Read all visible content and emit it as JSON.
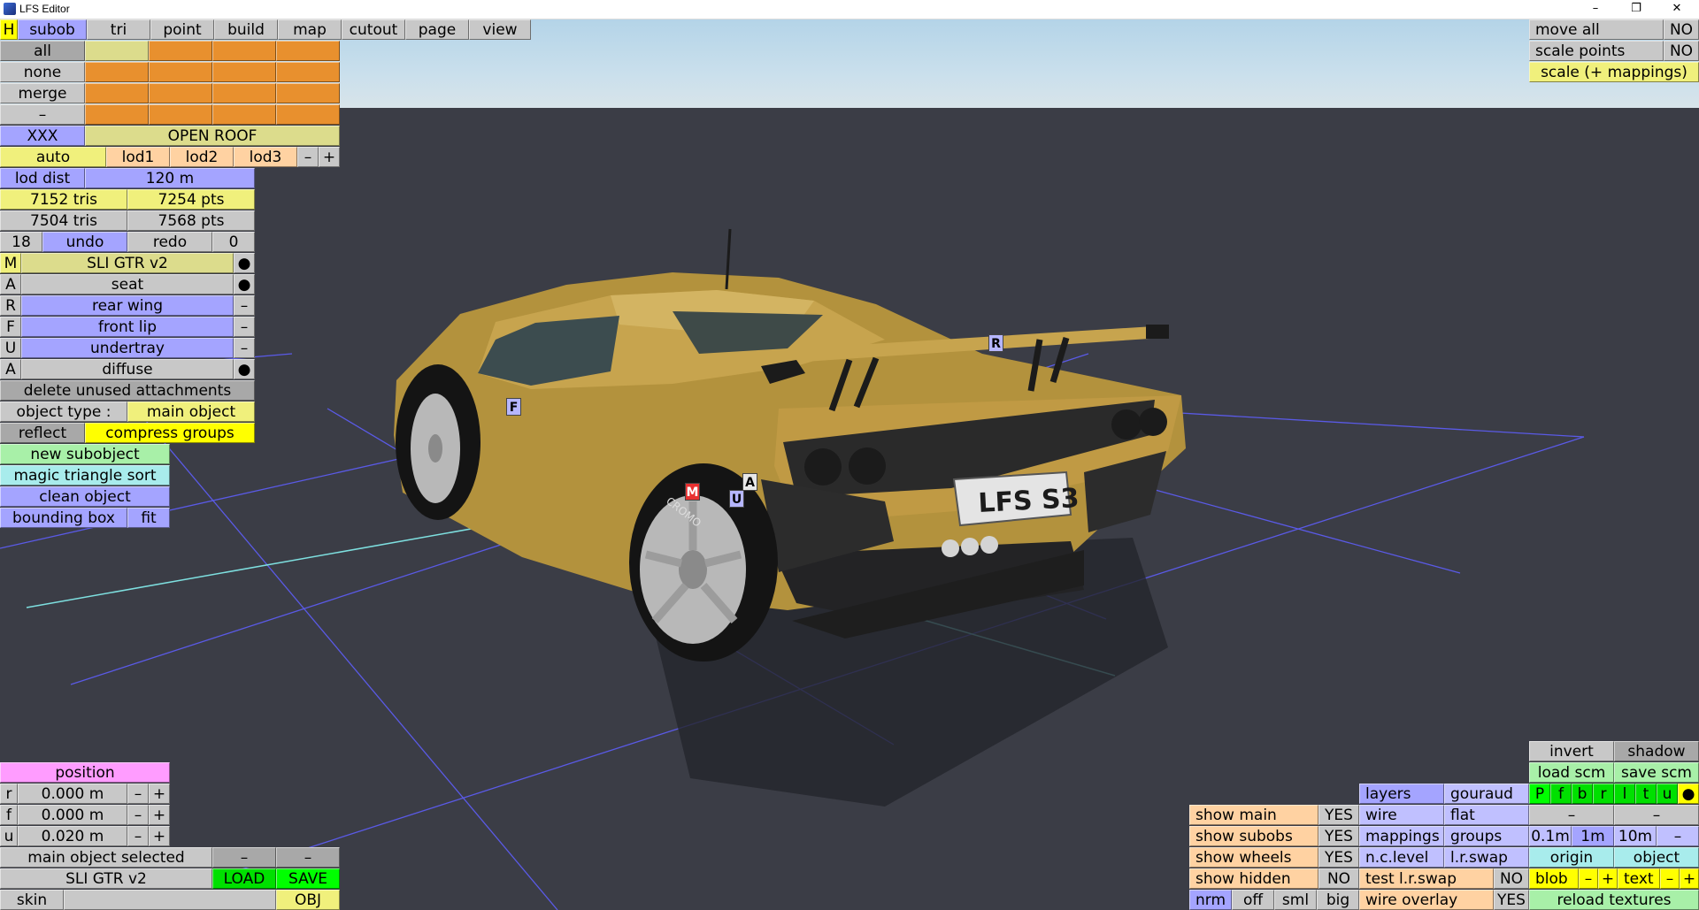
{
  "window": {
    "title": "LFS Editor",
    "minimize": "–",
    "restore": "❐",
    "close": "✕"
  },
  "top_tabs": {
    "h": "H",
    "subob": "subob",
    "tri": "tri",
    "point": "point",
    "build": "build",
    "map": "map",
    "cutout": "cutout",
    "page": "page",
    "view": "view"
  },
  "select": {
    "all": "all",
    "none": "none",
    "merge": "merge",
    "dash": "–",
    "xxx": "XXX",
    "open_roof": "OPEN ROOF"
  },
  "lod": {
    "auto": "auto",
    "lod1": "lod1",
    "lod2": "lod2",
    "lod3": "lod3",
    "minus": "–",
    "plus": "+",
    "lod_dist_label": "lod dist",
    "lod_dist_value": "120 m"
  },
  "stats": {
    "tris1": "7152 tris",
    "pts1": "7254 pts",
    "tris2": "7504 tris",
    "pts2": "7568 pts"
  },
  "history": {
    "undo_count": "18",
    "undo": "undo",
    "redo": "redo",
    "redo_count": "0"
  },
  "subobjects": [
    {
      "key": "M",
      "name": "SLI GTR v2",
      "flag": "●"
    },
    {
      "key": "A",
      "name": "seat",
      "flag": "●"
    },
    {
      "key": "R",
      "name": "rear wing",
      "flag": "–"
    },
    {
      "key": "F",
      "name": "front lip",
      "flag": "–"
    },
    {
      "key": "U",
      "name": "undertray",
      "flag": "–"
    },
    {
      "key": "A",
      "name": "diffuse",
      "flag": "●"
    }
  ],
  "actions": {
    "delete_unused": "delete unused attachments",
    "object_type_label": "object type :",
    "object_type_value": "main object",
    "reflect": "reflect",
    "compress_groups": "compress groups",
    "new_subobject": "new subobject",
    "magic_sort": "magic triangle sort",
    "clean_object": "clean object",
    "bounding_box": "bounding box",
    "fit": "fit"
  },
  "top_right": {
    "move_all": "move all",
    "move_all_val": "NO",
    "scale_points": "scale points",
    "scale_points_val": "NO",
    "scale_mappings": "scale (+ mappings)"
  },
  "position": {
    "title": "position",
    "rows": [
      {
        "axis": "r",
        "value": "0.000 m"
      },
      {
        "axis": "f",
        "value": "0.000 m"
      },
      {
        "axis": "u",
        "value": "0.020 m"
      }
    ],
    "minus": "–",
    "plus": "+"
  },
  "bottom_left": {
    "main_selected": "main object selected",
    "dash1": "–",
    "dash2": "–",
    "object_name": "SLI GTR v2",
    "load": "LOAD",
    "save": "SAVE",
    "skin": "skin",
    "obj": "OBJ"
  },
  "show": {
    "main": "show main",
    "main_val": "YES",
    "subobs": "show subobs",
    "subobs_val": "YES",
    "wheels": "show wheels",
    "wheels_val": "YES",
    "hidden": "show hidden",
    "hidden_val": "NO"
  },
  "render": {
    "nrm": "nrm",
    "off": "off",
    "sml": "sml",
    "big": "big",
    "layers": "layers",
    "gouraud": "gouraud",
    "wire": "wire",
    "flat": "flat",
    "mappings": "mappings",
    "groups": "groups",
    "nclevel": "n.c.level",
    "lrswap": "l.r.swap",
    "test_lrswap": "test l.r.swap",
    "test_lrswap_val": "NO",
    "wire_overlay": "wire overlay",
    "wire_overlay_val": "YES"
  },
  "right_tools": {
    "invert": "invert",
    "shadow": "shadow",
    "load_scm": "load scm",
    "save_scm": "save scm",
    "channels": [
      "P",
      "f",
      "b",
      "r",
      "l",
      "t",
      "u",
      "●"
    ],
    "dash_a": "–",
    "dash_b": "–",
    "g01": "0.1m",
    "g1": "1m",
    "g10": "10m",
    "g_minus": "–",
    "origin": "origin",
    "object": "object",
    "blob": "blob",
    "minus": "–",
    "plus": "+",
    "text": "text",
    "reload_textures": "reload textures"
  },
  "markers": {
    "F": "F",
    "R": "R",
    "M": "M",
    "U": "U",
    "A": "A"
  },
  "plate": "LFS S3",
  "tire_text": "CROMO"
}
